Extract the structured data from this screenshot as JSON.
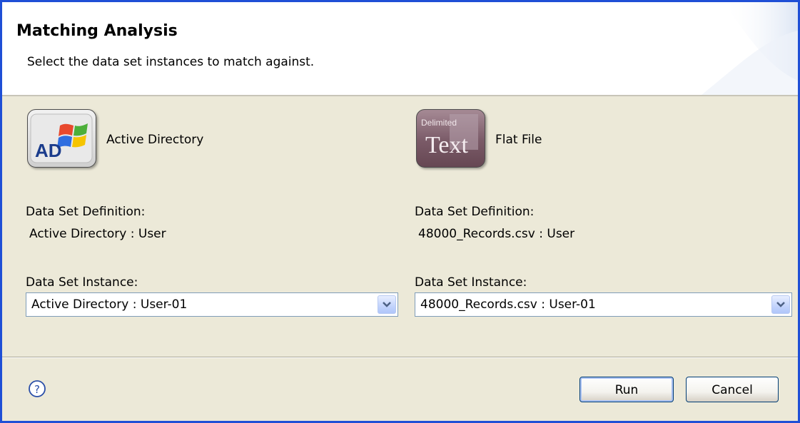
{
  "header": {
    "title": "Matching Analysis",
    "subtitle": "Select the data set instances to match against."
  },
  "left": {
    "icon": "active-directory-icon",
    "icon_text": "AD",
    "name": "Active Directory",
    "definition_label": "Data Set Definition:",
    "definition_value": "Active Directory : User",
    "instance_label": "Data Set Instance:",
    "instance_value": "Active Directory : User-01"
  },
  "right": {
    "icon": "delimited-text-icon",
    "icon_caption": "Delimited",
    "icon_text": "Text",
    "name": "Flat File",
    "definition_label": "Data Set Definition:",
    "definition_value": "48000_Records.csv : User",
    "instance_label": "Data Set Instance:",
    "instance_value": "48000_Records.csv : User-01"
  },
  "footer": {
    "help_icon": "help-icon",
    "run_label": "Run",
    "cancel_label": "Cancel"
  },
  "colors": {
    "dialog_border": "#1f4fd6",
    "dialog_background": "#ece9d8",
    "header_background": "#ffffff",
    "button_border": "#003c74",
    "combo_border": "#7f9db9"
  }
}
